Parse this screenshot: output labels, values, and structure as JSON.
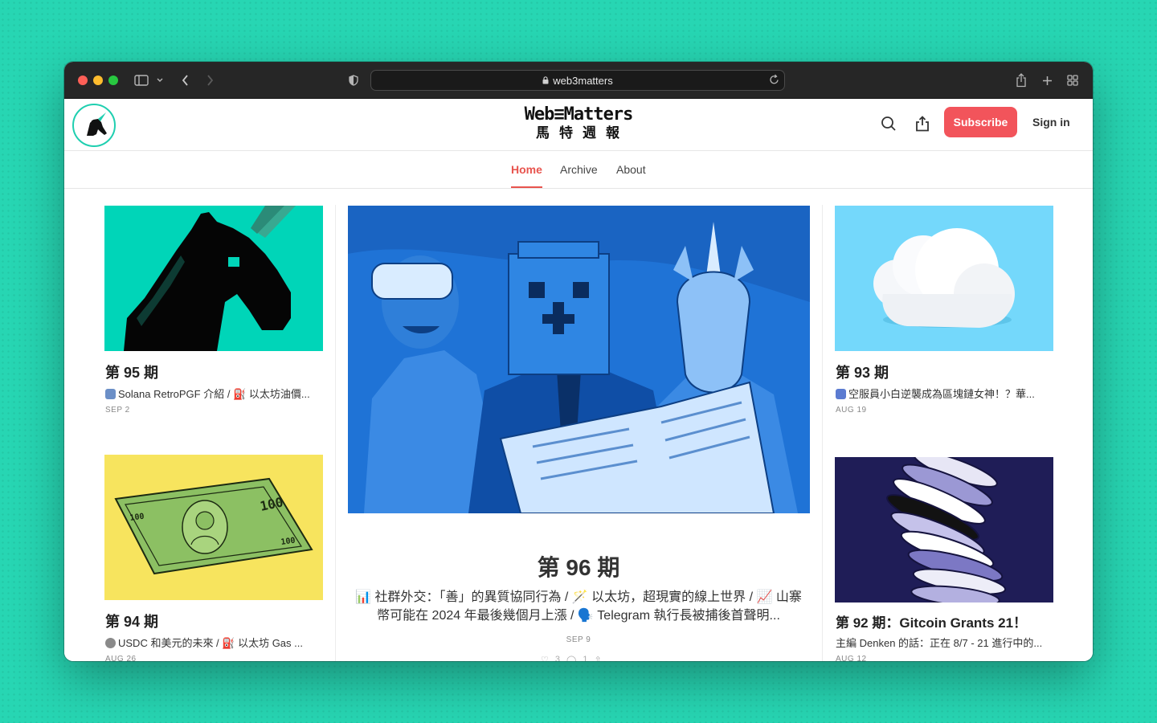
{
  "browser": {
    "url": "web3matters"
  },
  "site": {
    "logo_en": "Web≡Matters",
    "logo_zh": "馬特週報",
    "subscribe_label": "Subscribe",
    "signin_label": "Sign in"
  },
  "nav": {
    "items": [
      {
        "label": "Home",
        "active": true
      },
      {
        "label": "Archive",
        "active": false
      },
      {
        "label": "About",
        "active": false
      }
    ]
  },
  "posts": {
    "featured": {
      "title": "第 96 期",
      "subtitle": "📊 社群外交：「善」的異質協同行為 / 🪄 以太坊，超現實的線上世界 / 📈 山寨幣可能在 2024 年最後幾個月上漲 / 🗣️ Telegram 執行長被捕後首聲明...",
      "date": "SEP 9",
      "likes": "3",
      "comments": "1"
    },
    "left": [
      {
        "title": "第 95 期",
        "subtitle": "Solana RetroPGF 介紹 / ⛽ 以太坊油價...",
        "date": "SEP 2"
      },
      {
        "title": "第 94 期",
        "subtitle": "USDC 和美元的未來 / ⛽ 以太坊 Gas ...",
        "date": "AUG 26"
      }
    ],
    "right": [
      {
        "title": "第 93 期",
        "subtitle": "空服員小白逆襲成為區塊鏈女神！？華...",
        "date": "AUG 19"
      },
      {
        "title": "第 92 期：Gitcoin Grants 21！",
        "subtitle": "主編 Denken 的話：正在 8/7 - 21 進行中的...",
        "date": "AUG 12"
      }
    ]
  },
  "colors": {
    "accent": "#f2545b",
    "background": "#27d6b3",
    "teal_image": "#00d5b8",
    "featured_blue": "#1f73d6",
    "cloud_bg": "#74d8fb",
    "yellow_bg": "#f7e45e",
    "navy_bg": "#1f1d57"
  }
}
